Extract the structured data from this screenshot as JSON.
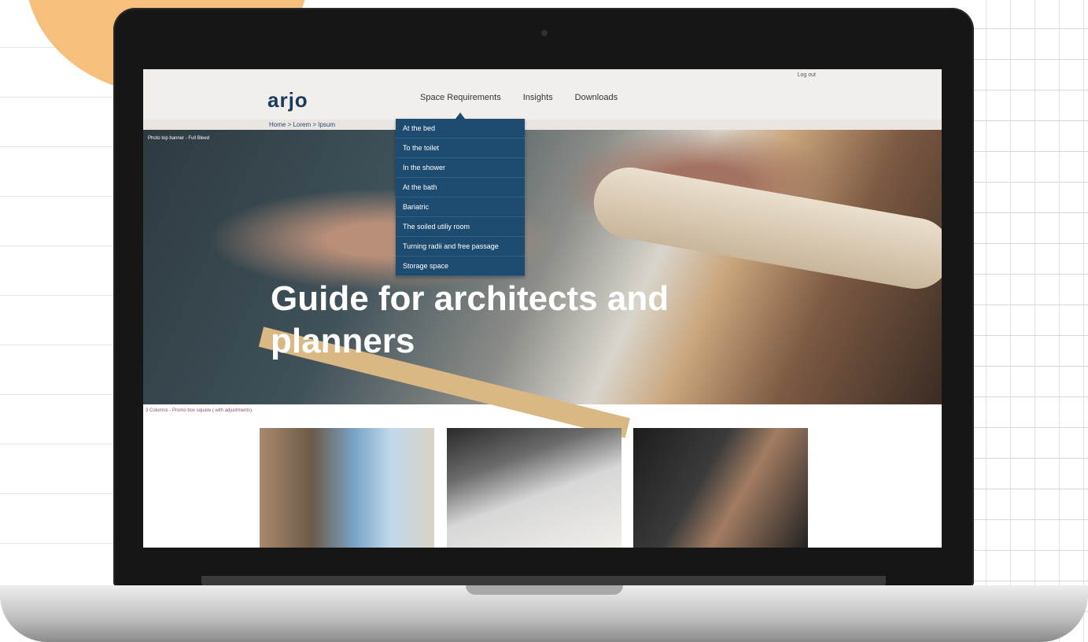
{
  "site": {
    "logo_text": "arjo",
    "logout": "Log out"
  },
  "nav": {
    "items": [
      "Space Requirements",
      "Insights",
      "Downloads"
    ],
    "active": "Space Requirements"
  },
  "breadcrumb": "Home > Lorem > Ipsum",
  "hero": {
    "caption": "Photo top banner - Full Bleed",
    "title": "Guide for architects and planners"
  },
  "dropdown": {
    "items": [
      "At the bed",
      "To the toilet",
      "In the shower",
      " At the bath",
      "Bariatric",
      "The soiled utiliy room",
      "Turning radii and free passage",
      "Storage space"
    ]
  },
  "promos": {
    "caption": "3 Columns - Promo box square ( with adjustments)."
  },
  "colors": {
    "accent_orange": "#f6c07c",
    "dropdown_bg": "#1d4c70",
    "brand_blue": "#1a3b5c",
    "topbar_bg": "#f2eeec"
  }
}
